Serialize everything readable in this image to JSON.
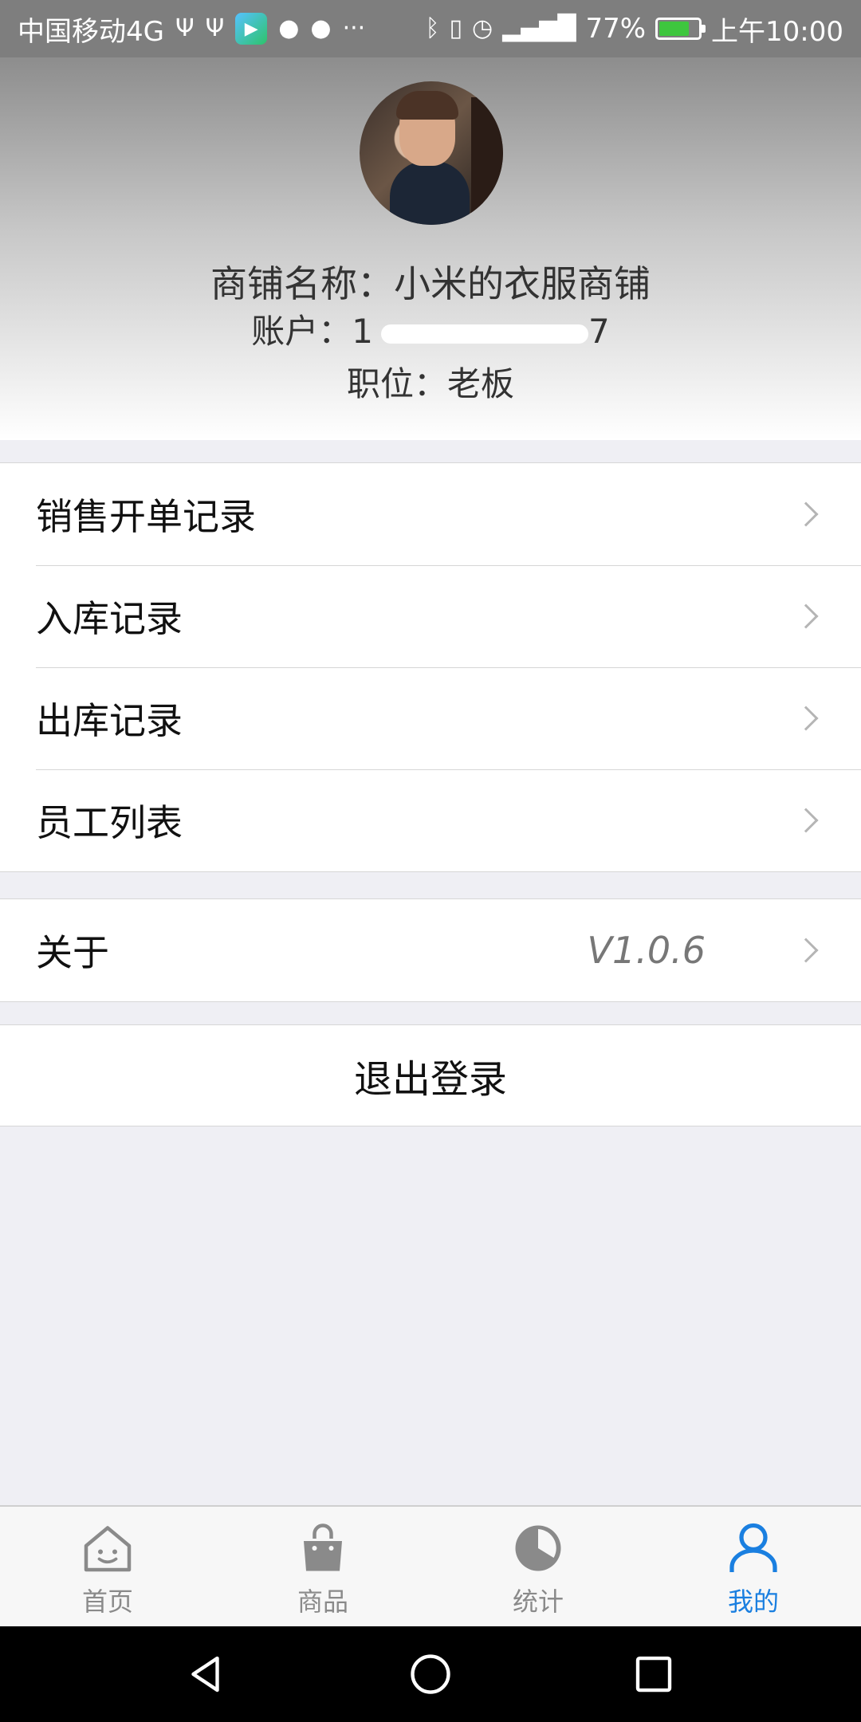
{
  "status_bar": {
    "carrier": "中国移动4G",
    "battery": "77%",
    "battery_level": 0.77,
    "time": "上午10:00",
    "network": "4G"
  },
  "profile": {
    "shop_name": "商铺名称：小米的衣服商铺",
    "account_label": "账户：1",
    "account_tail": "7",
    "role": "职位：老板"
  },
  "menu": {
    "items": [
      {
        "label": "销售开单记录"
      },
      {
        "label": "入库记录"
      },
      {
        "label": "出库记录"
      },
      {
        "label": "员工列表"
      }
    ],
    "about_label": "关于",
    "version": "V1.0.6",
    "logout_label": "退出登录"
  },
  "tabbar": {
    "tabs": [
      {
        "label": "首页",
        "icon": "home-icon"
      },
      {
        "label": "商品",
        "icon": "bag-icon"
      },
      {
        "label": "统计",
        "icon": "pie-icon"
      },
      {
        "label": "我的",
        "icon": "user-icon",
        "active": true
      }
    ],
    "active_color": "#1a7fe0",
    "inactive_color": "#8a8a8a"
  }
}
